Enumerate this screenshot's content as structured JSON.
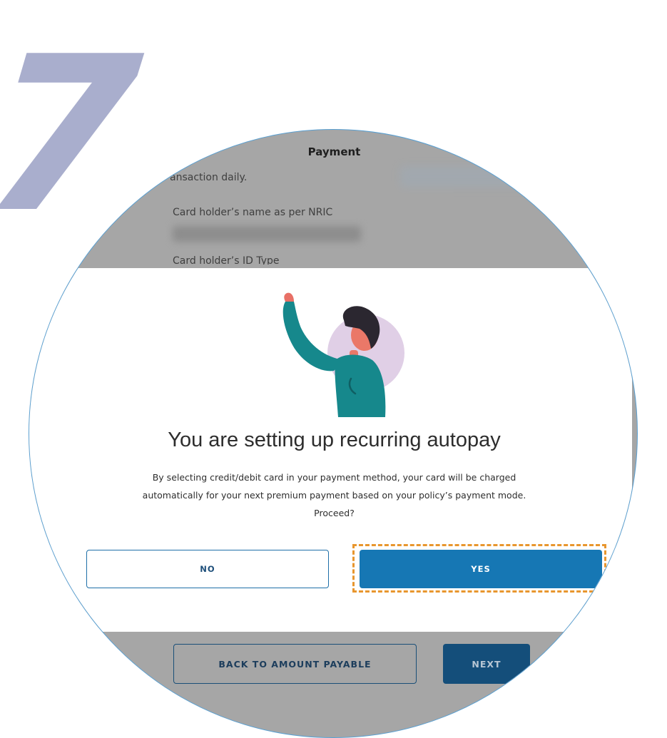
{
  "step_number": "7",
  "page": {
    "title": "Payment",
    "partial_text": "ansaction daily.",
    "card_holder_name_label": "Card holder’s name as per NRIC",
    "card_holder_id_type_label": "Card holder’s ID Type"
  },
  "modal": {
    "title": "You are setting up recurring autopay",
    "body_line1": "By selecting credit/debit card in your payment method, your card will be charged",
    "body_line2": "automatically for your next premium payment based on your policy’s payment mode.",
    "body_line3": "Proceed?",
    "no_label": "NO",
    "yes_label": "YES",
    "close_symbol": "×"
  },
  "footer": {
    "back_label": "BACK TO AMOUNT PAYABLE",
    "next_label": "NEXT"
  },
  "icons": [
    "close-icon",
    "waving-person-illustration"
  ],
  "colors": {
    "primary": "#1677b4",
    "highlight": "#e8962e",
    "step_number": "#a9aecd",
    "overlay": "#a6a6a6"
  }
}
